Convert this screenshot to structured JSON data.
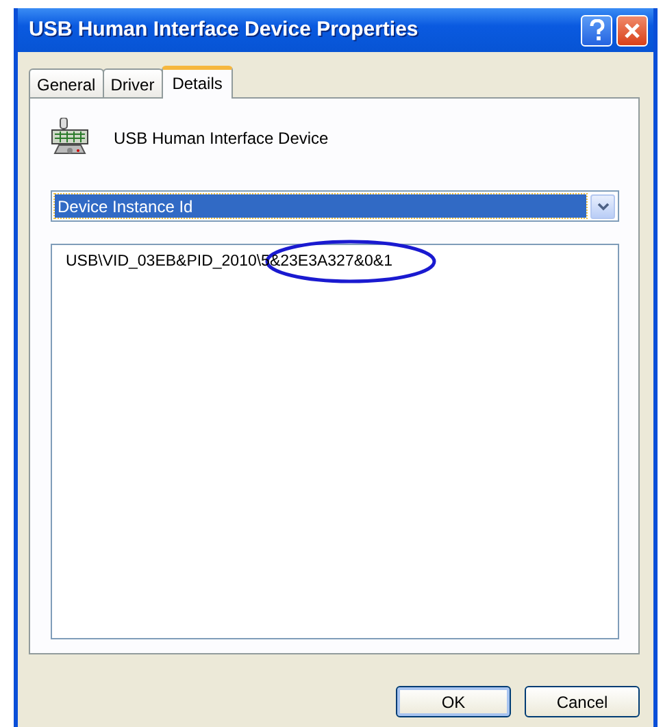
{
  "window": {
    "title": "USB Human Interface Device Properties"
  },
  "tabs": [
    {
      "label": "General",
      "selected": false
    },
    {
      "label": "Driver",
      "selected": false
    },
    {
      "label": "Details",
      "selected": true
    }
  ],
  "device": {
    "name": "USB Human Interface Device"
  },
  "property": {
    "value": "Device Instance Id"
  },
  "values": [
    {
      "text": "USB\\VID_03EB&PID_2010\\5&23E3A327&0&1",
      "highlighted": true
    }
  ],
  "buttons": [
    {
      "label": "OK",
      "default": true
    },
    {
      "label": "Cancel",
      "default": false
    }
  ]
}
